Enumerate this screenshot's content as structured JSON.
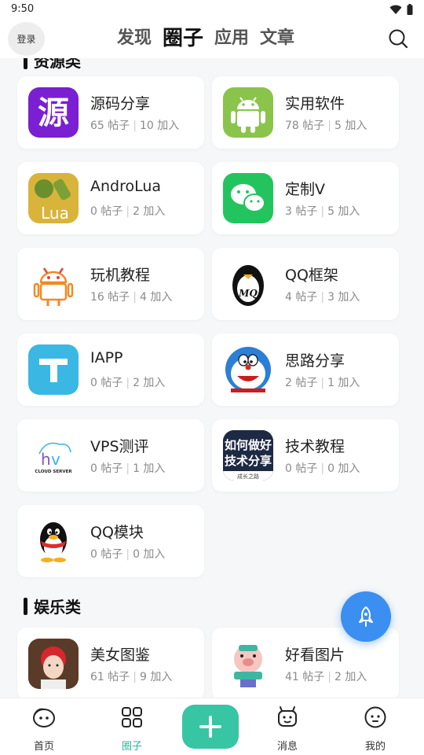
{
  "status": {
    "time": "9:50"
  },
  "header": {
    "login_label": "登录",
    "tabs": [
      {
        "label": "发现"
      },
      {
        "label": "圈子"
      },
      {
        "label": "应用"
      },
      {
        "label": "文章"
      }
    ]
  },
  "sections": [
    {
      "title": "资源类",
      "items": [
        {
          "name": "源码分享",
          "posts": "65 帖子",
          "joined": "10 加入",
          "icon_text": "源"
        },
        {
          "name": "实用软件",
          "posts": "78 帖子",
          "joined": "5 加入"
        },
        {
          "name": "AndroLua",
          "posts": "0 帖子",
          "joined": "2 加入",
          "icon_text": "Lua"
        },
        {
          "name": "定制V",
          "posts": "3 帖子",
          "joined": "5 加入"
        },
        {
          "name": "玩机教程",
          "posts": "16 帖子",
          "joined": "4 加入"
        },
        {
          "name": "QQ框架",
          "posts": "4 帖子",
          "joined": "3 加入",
          "icon_text": "MQ"
        },
        {
          "name": "IAPP",
          "posts": "0 帖子",
          "joined": "2 加入"
        },
        {
          "name": "思路分享",
          "posts": "2 帖子",
          "joined": "1 加入"
        },
        {
          "name": "VPS测评",
          "posts": "0 帖子",
          "joined": "1 加入",
          "icon_text": "CLOUD SERVER"
        },
        {
          "name": "技术教程",
          "posts": "0 帖子",
          "joined": "0 加入",
          "icon_text": "如何做好技术分享"
        },
        {
          "name": "QQ模块",
          "posts": "0 帖子",
          "joined": "0 加入"
        }
      ]
    },
    {
      "title": "娱乐类",
      "items": [
        {
          "name": "美女图鉴",
          "posts": "61 帖子",
          "joined": "9 加入"
        },
        {
          "name": "好看图片",
          "posts": "41 帖子",
          "joined": "2 加入"
        }
      ]
    }
  ],
  "bottom_nav": [
    {
      "label": "首页"
    },
    {
      "label": "圈子"
    },
    {
      "label": "消息"
    },
    {
      "label": "我的"
    }
  ],
  "colors": {
    "accent": "#37c5a4",
    "fab": "#3a8ff0"
  }
}
